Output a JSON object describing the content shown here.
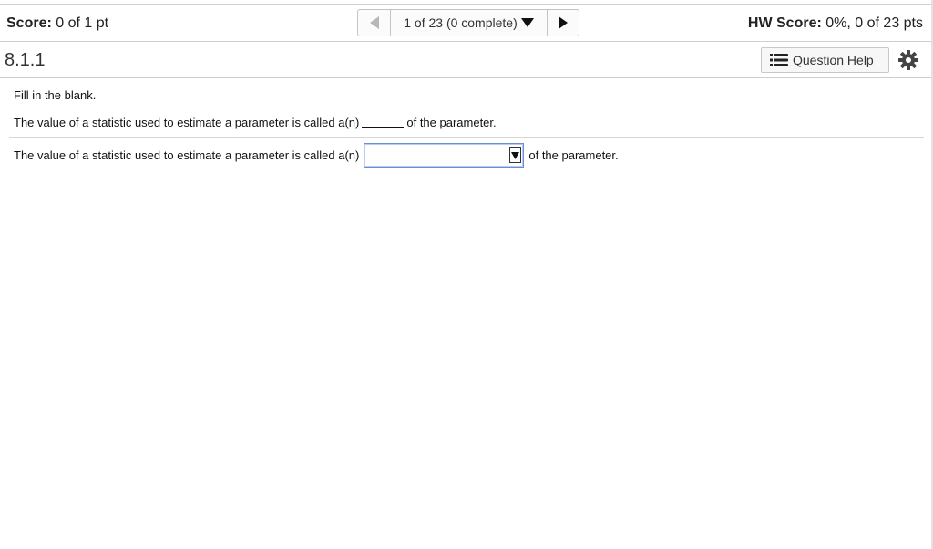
{
  "header": {
    "score_label": "Score:",
    "score_value": "0 of 1 pt",
    "progress": "1 of 23 (0 complete)",
    "hw_score_label": "HW Score:",
    "hw_score_value": "0%, 0 of 23 pts"
  },
  "question_bar": {
    "number": "8.1.1",
    "help_label": "Question Help"
  },
  "content": {
    "instruction": "Fill in the blank.",
    "statement_prefix": "The value of a statistic used to estimate a parameter is called a(n)",
    "statement_suffix": "of the parameter.",
    "answer_prefix": "The value of a statistic used to estimate a parameter is called a(n)",
    "answer_selected": "",
    "answer_suffix": "of the parameter."
  },
  "colors": {
    "select_border": "#6b8fd6",
    "nav_disabled_arrow": "#b7b7b7"
  },
  "icons": [
    "prev-arrow-icon",
    "dropdown-triangle-icon",
    "next-arrow-icon",
    "list-icon",
    "gear-icon",
    "select-arrow-icon"
  ]
}
